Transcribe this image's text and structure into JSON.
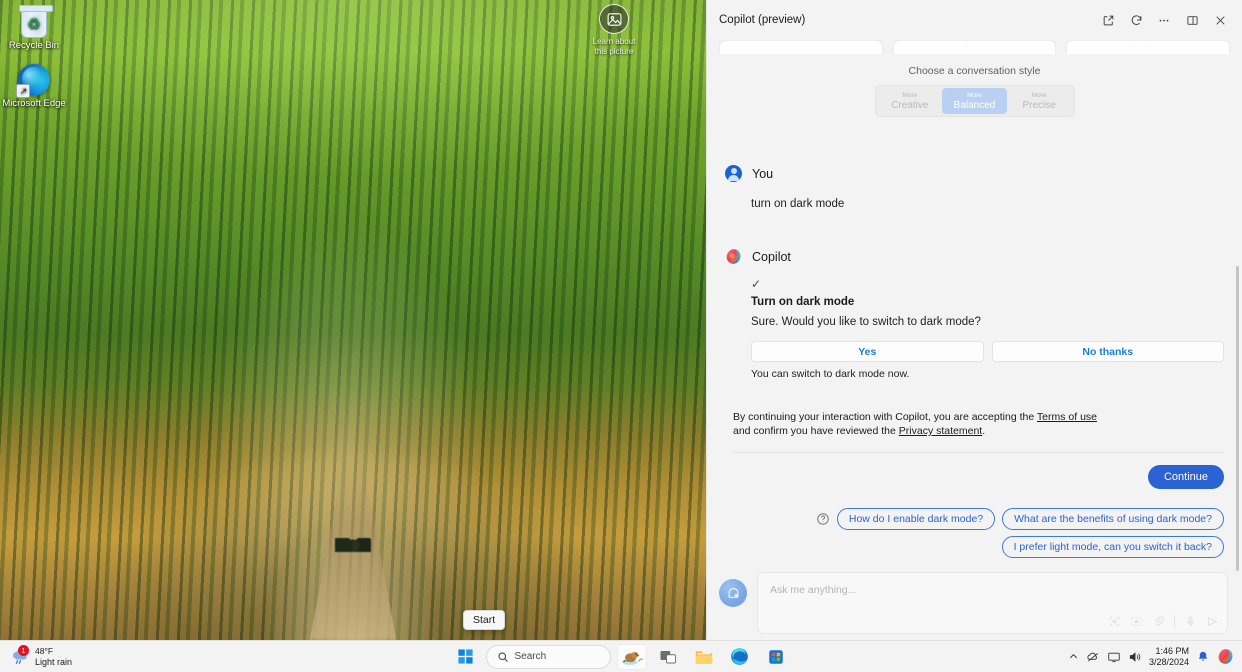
{
  "desktop": {
    "icons": [
      {
        "name": "recycle-bin",
        "label": "Recycle Bin"
      },
      {
        "name": "microsoft-edge",
        "label": "Microsoft Edge"
      }
    ],
    "learn_picture": {
      "line1": "Learn about",
      "line2": "this picture",
      "icon": "image-icon"
    },
    "start_tooltip": "Start"
  },
  "copilot": {
    "title": "Copilot (preview)",
    "header_buttons": [
      {
        "name": "open-in-new-window-button",
        "icon": "open-in-new-icon"
      },
      {
        "name": "refresh-button",
        "icon": "refresh-icon"
      },
      {
        "name": "more-options-button",
        "icon": "ellipsis-icon"
      },
      {
        "name": "split-pane-button",
        "icon": "split-pane-icon"
      },
      {
        "name": "close-button",
        "icon": "close-icon"
      }
    ],
    "style": {
      "label": "Choose a conversation style",
      "options": [
        {
          "top": "More",
          "bottom": "Creative",
          "selected": false
        },
        {
          "top": "More",
          "bottom": "Balanced",
          "selected": true
        },
        {
          "top": "More",
          "bottom": "Precise",
          "selected": false
        }
      ]
    },
    "messages": [
      {
        "author": "You",
        "avatar": "user-avatar",
        "text": "turn on dark mode"
      },
      {
        "author": "Copilot",
        "avatar": "copilot-avatar",
        "check": "✓",
        "card_title": "Turn on dark mode",
        "card_sub": "Sure. Would you like to switch to dark mode?",
        "choices": [
          {
            "label": "Yes"
          },
          {
            "label": "No thanks"
          }
        ],
        "after_note": "You can switch to dark mode now."
      }
    ],
    "terms": {
      "before_link1": "By continuing your interaction with Copilot, you are accepting the ",
      "link1": "Terms of use",
      "between": " and confirm you have reviewed the ",
      "link2": "Privacy statement",
      "after": "."
    },
    "continue_label": "Continue",
    "suggestions": {
      "icon": "question-circle-icon",
      "chips": [
        "How do I enable dark mode?",
        "What are the benefits of using dark mode?",
        "I prefer light mode, can you switch it back?"
      ]
    },
    "input": {
      "placeholder": "Ask me anything...",
      "value": "",
      "avatar": "copilot-input-avatar",
      "buttons": [
        {
          "name": "scan-icon"
        },
        {
          "name": "image-search-icon"
        },
        {
          "name": "attachment-icon"
        },
        {
          "name": "microphone-icon"
        },
        {
          "name": "send-icon"
        }
      ]
    }
  },
  "taskbar": {
    "weather": {
      "temperature": "48°F",
      "condition": "Light rain",
      "badge": "1"
    },
    "start": {
      "name": "start-button"
    },
    "search": {
      "placeholder": "Search",
      "value": ""
    },
    "apps": [
      {
        "name": "taskbar-copilot",
        "active": true
      },
      {
        "name": "taskbar-task-view",
        "active": false
      },
      {
        "name": "taskbar-file-explorer",
        "active": false
      },
      {
        "name": "taskbar-microsoft-edge",
        "active": false
      },
      {
        "name": "taskbar-microsoft-store",
        "active": false
      }
    ],
    "tray": {
      "chevron": "show-hidden-icons",
      "network": "network-icon",
      "display": "display-icon",
      "volume": "volume-icon",
      "time": "1:46 PM",
      "date": "3/28/2024",
      "notification": "bell-icon",
      "copilot": "copilot-tray-icon"
    }
  },
  "colors": {
    "accent": "#2b62d4",
    "link": "#1a7fd4",
    "selected_pill": "#b9d0f0",
    "badge": "#e81123"
  }
}
